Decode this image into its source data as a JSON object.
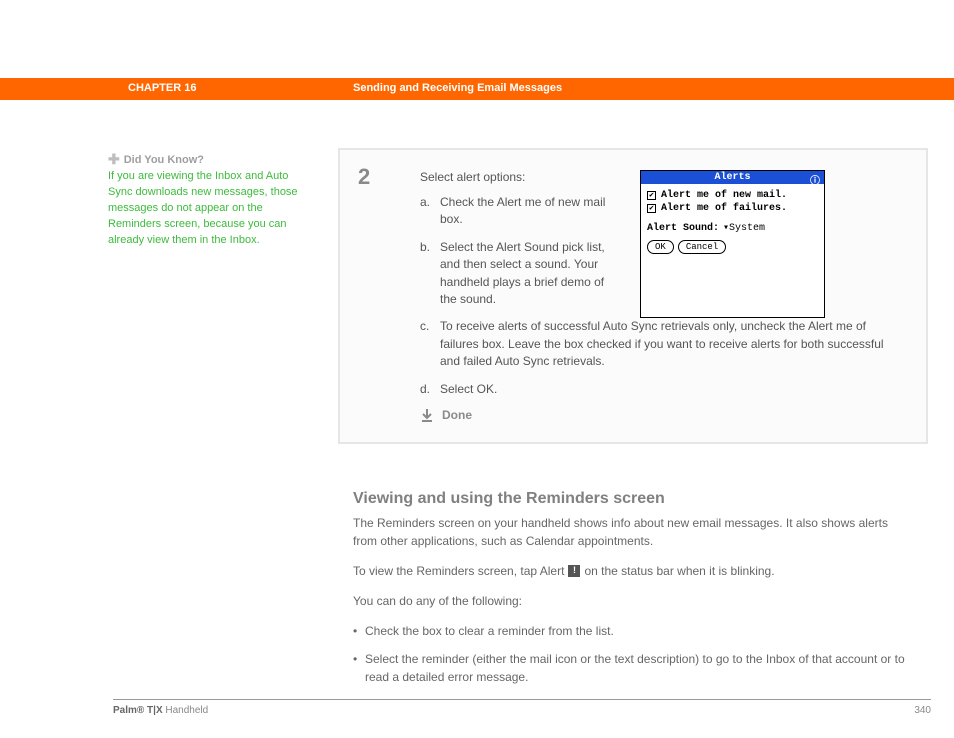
{
  "header": {
    "chapter": "CHAPTER 16",
    "title": "Sending and Receiving Email Messages"
  },
  "sidebar": {
    "heading": "Did You Know?",
    "body": "If you are viewing the Inbox and Auto Sync downloads new messages, those messages do not appear on the Reminders screen, because you can already view them in the Inbox."
  },
  "step": {
    "number": "2",
    "intro": "Select alert options:",
    "items": [
      {
        "label": "a.",
        "text": "Check the Alert me of new mail box."
      },
      {
        "label": "b.",
        "text": "Select the Alert Sound pick list, and then select a sound. Your handheld plays a brief demo of the sound."
      },
      {
        "label": "c.",
        "text": "To receive alerts of successful Auto Sync retrievals only, uncheck the Alert me of failures box. Leave the box checked if you want to receive alerts for both successful and failed Auto Sync retrievals."
      },
      {
        "label": "d.",
        "text": "Select OK."
      }
    ],
    "done": "Done"
  },
  "dialog": {
    "title": "Alerts",
    "check1": "Alert me of new mail.",
    "check2": "Alert me of failures.",
    "sound_label": "Alert Sound:",
    "sound_value": "System",
    "ok": "OK",
    "cancel": "Cancel"
  },
  "section": {
    "heading": "Viewing and using the Reminders screen",
    "p1": "The Reminders screen on your handheld shows info about new email messages. It also shows alerts from other applications, such as Calendar appointments.",
    "p2a": "To view the Reminders screen, tap Alert ",
    "p2b": " on the status bar when it is blinking.",
    "p3": "You can do any of the following:",
    "bullets": [
      "Check the box to clear a reminder from the list.",
      "Select the reminder (either the mail icon or the text description) to go to the Inbox of that account or to read a detailed error message."
    ]
  },
  "footer": {
    "product_bold": "Palm® T|X",
    "product_rest": " Handheld",
    "page": "340"
  }
}
